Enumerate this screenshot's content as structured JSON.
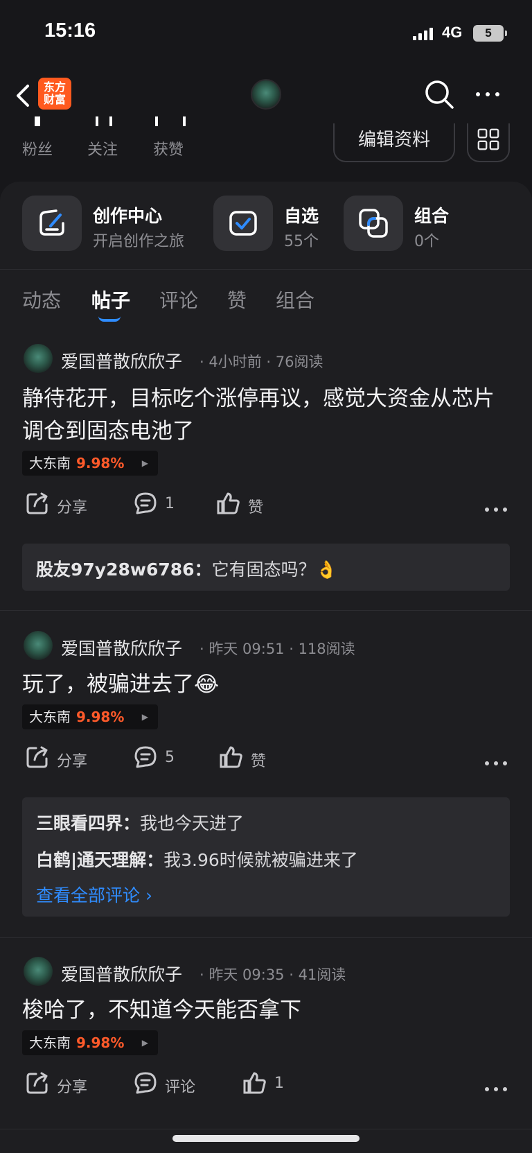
{
  "status_bar": {
    "time": "15:16",
    "network": "4G",
    "battery": "5"
  },
  "nav": {
    "logo_text": "东方财富",
    "logo_line1": "东方",
    "logo_line2": "财富",
    "back_icon": "chevron-left-icon",
    "search_icon": "search-icon",
    "more_icon": "more-horizontal-icon"
  },
  "profile": {
    "stats": [
      {
        "label": "粉丝"
      },
      {
        "label": "关注"
      },
      {
        "label": "获赞"
      }
    ],
    "edit_button": "编辑资料",
    "qr_icon": "qr-code-icon"
  },
  "features": [
    {
      "title": "创作中心",
      "subtitle": "开启创作之旅",
      "icon": "edit-pen-icon"
    },
    {
      "title": "自选",
      "subtitle": "55个",
      "icon": "check-box-icon"
    },
    {
      "title": "组合",
      "subtitle": "0个",
      "icon": "portfolio-icon"
    }
  ],
  "tabs": [
    {
      "label": "动态",
      "active": false
    },
    {
      "label": "帖子",
      "active": true
    },
    {
      "label": "评论",
      "active": false
    },
    {
      "label": "赞",
      "active": false
    },
    {
      "label": "组合",
      "active": false
    }
  ],
  "posts": [
    {
      "author": "爱国普散欣欣子",
      "meta": "· 4小时前 · 76阅读",
      "text": "静待花开，目标吃个涨停再议，感觉大资金从芯片调仓到固态电池了",
      "stock": {
        "name": "大东南",
        "change": "9.98%"
      },
      "actions": {
        "share": "分享",
        "comment": "1",
        "like": "赞"
      },
      "comments": [
        {
          "user": "股友97y28w6786：",
          "text": "它有固态吗？👌"
        }
      ]
    },
    {
      "author": "爱国普散欣欣子",
      "meta": "· 昨天 09:51 · 118阅读",
      "text": "玩了，被骗进去了😂",
      "stock": {
        "name": "大东南",
        "change": "9.98%"
      },
      "actions": {
        "share": "分享",
        "comment": "5",
        "like": "赞"
      },
      "comments": [
        {
          "user": "三眼看四界：",
          "text": "我也今天进了"
        },
        {
          "user": "白鹤|通天理解：",
          "text": "我3.96时候就被骗进来了"
        }
      ],
      "view_all": "查看全部评论 ›"
    },
    {
      "author": "爱国普散欣欣子",
      "meta": "· 昨天 09:35 · 41阅读",
      "text": "梭哈了，不知道今天能否拿下",
      "stock": {
        "name": "大东南",
        "change": "9.98%"
      },
      "actions": {
        "share": "分享",
        "comment": "评论",
        "like": "1"
      }
    }
  ],
  "colors": {
    "background": "#17171a",
    "card": "#1e1e21",
    "accent": "#2f8cff",
    "rise": "#ff5a2a",
    "logo": "#ff5a1f"
  }
}
